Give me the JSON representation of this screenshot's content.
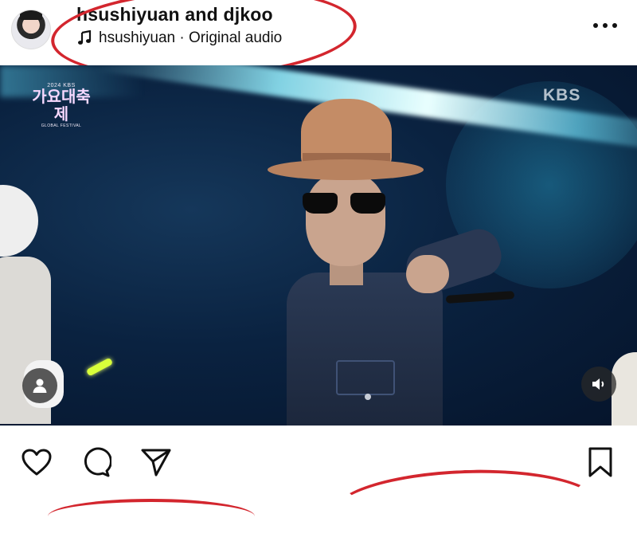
{
  "post": {
    "title": "hsushiyuan and djkoo",
    "audio": "hsushiyuan · Original audio"
  },
  "video": {
    "logo_small": "2024 KBS",
    "logo_big": "가요대축제",
    "logo_tiny": "GLOBAL FESTIVAL",
    "channel_mark": "KBS"
  },
  "icons": {
    "more": "more-horizontal-icon",
    "music": "music-note-icon",
    "tag": "person-tag-icon",
    "sound": "speaker-icon",
    "like": "heart-icon",
    "comment": "comment-icon",
    "share": "send-icon",
    "save": "bookmark-icon"
  },
  "colors": {
    "annotation": "#d3262e",
    "text": "#111111",
    "background": "#ffffff"
  }
}
